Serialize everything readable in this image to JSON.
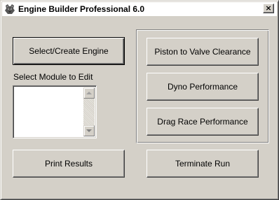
{
  "window": {
    "title": "Engine Builder Professional 6.0",
    "close_label": "×"
  },
  "buttons": {
    "select_engine": "Select/Create Engine",
    "print_results": "Print Results",
    "piston_valve": "Piston to Valve Clearance",
    "dyno": "Dyno Performance",
    "drag_race": "Drag Race Performance",
    "terminate": "Terminate Run"
  },
  "module_list": {
    "label": "Select Module to Edit",
    "items": []
  },
  "icons": {
    "app": "wolf-head-icon",
    "close": "close-icon",
    "scroll_up": "chevron-up-icon",
    "scroll_down": "chevron-down-icon"
  }
}
